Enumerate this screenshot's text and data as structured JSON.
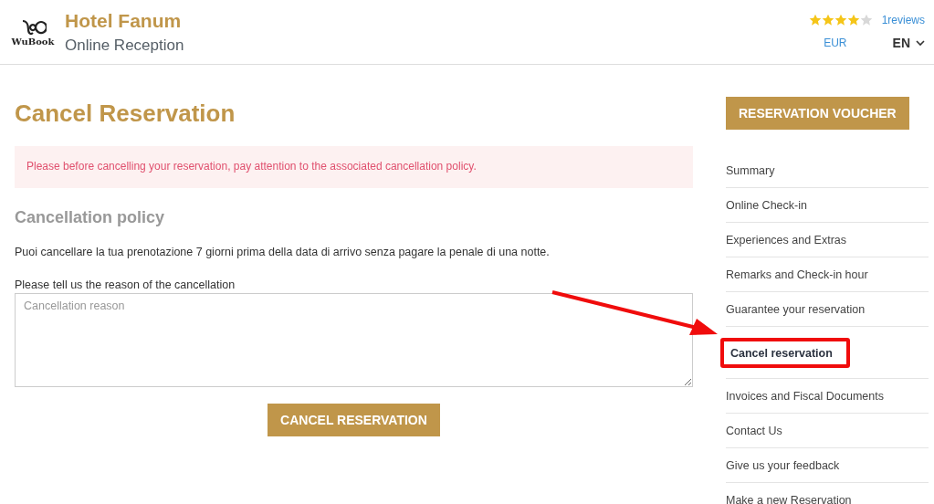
{
  "header": {
    "logo_text": "WuBook",
    "hotel_name": "Hotel Fanum",
    "subtitle": "Online Reception",
    "stars": 4,
    "reviews": "1reviews",
    "currency": "EUR",
    "language": "EN"
  },
  "page_title": "Cancel Reservation",
  "alert": "Please before cancelling your reservation, pay attention to the associated cancellation policy.",
  "policy": {
    "heading": "Cancellation policy",
    "text": "Puoi cancellare la tua prenotazione 7 giorni prima della data di arrivo senza pagare la penale di una notte."
  },
  "reason": {
    "label": "Please tell us the reason of the cancellation",
    "placeholder": "Cancellation reason"
  },
  "submit_button": "CANCEL RESERVATION",
  "voucher_button": "RESERVATION VOUCHER",
  "menu": [
    {
      "label": "Summary",
      "selected": false
    },
    {
      "label": "Online Check-in",
      "selected": false
    },
    {
      "label": "Experiences and Extras",
      "selected": false
    },
    {
      "label": "Remarks and Check-in hour",
      "selected": false
    },
    {
      "label": "Guarantee your reservation",
      "selected": false
    },
    {
      "label": "Cancel reservation",
      "selected": true
    },
    {
      "label": "Invoices and Fiscal Documents",
      "selected": false
    },
    {
      "label": "Contact Us",
      "selected": false
    },
    {
      "label": "Give us your feedback",
      "selected": false
    },
    {
      "label": "Make a new Reservation",
      "selected": false
    }
  ]
}
